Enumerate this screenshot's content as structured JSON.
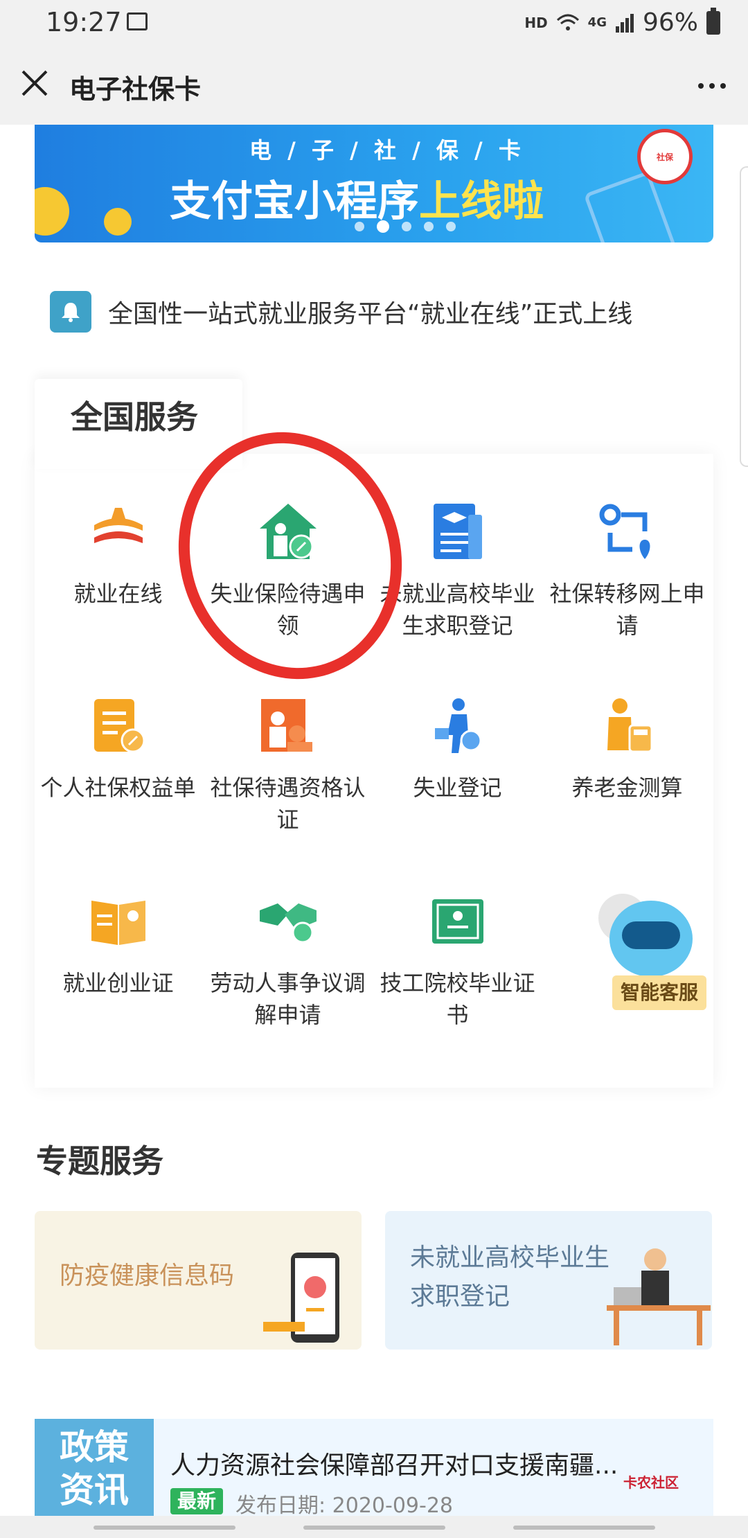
{
  "status_bar": {
    "time": "19:27",
    "hd": "HD",
    "network": "4G",
    "battery": "96%"
  },
  "app_bar": {
    "title": "电子社保卡"
  },
  "banner": {
    "subtitle": "电 / 子 / 社 / 保 / 卡",
    "title_main": "支付宝小程序",
    "title_highlight": "上线啦",
    "slides": 5,
    "active_slide": 1
  },
  "notice": {
    "text": "全国性一站式就业服务平台“就业在线”正式上线"
  },
  "national_services": {
    "title": "全国服务",
    "items": [
      {
        "label": "就业在线",
        "icon": "employment-online-icon"
      },
      {
        "label": "失业保险待遇申领",
        "icon": "unemployment-insurance-icon"
      },
      {
        "label": "未就业高校毕业生求职登记",
        "icon": "graduate-registration-icon"
      },
      {
        "label": "社保转移网上申请",
        "icon": "transfer-icon"
      },
      {
        "label": "个人社保权益单",
        "icon": "rights-document-icon"
      },
      {
        "label": "社保待遇资格认证",
        "icon": "qualification-icon"
      },
      {
        "label": "失业登记",
        "icon": "unemployment-registration-icon"
      },
      {
        "label": "养老金测算",
        "icon": "pension-calculator-icon"
      },
      {
        "label": "就业创业证",
        "icon": "certificate-book-icon"
      },
      {
        "label": "劳动人事争议调解申请",
        "icon": "handshake-icon"
      },
      {
        "label": "技工院校毕业证书",
        "icon": "diploma-icon"
      },
      {
        "label": "",
        "icon": "hidden-service-icon"
      }
    ]
  },
  "smart_service": {
    "label": "智能客服"
  },
  "topic_services": {
    "title": "专题服务",
    "cards": [
      {
        "text": "防疫健康信息码"
      },
      {
        "text_line1": "未就业高校毕业生",
        "text_line2": "求职登记"
      }
    ]
  },
  "policy": {
    "side_line1": "政策",
    "side_line2": "资讯",
    "title": "人力资源社会保障部召开对口支援南疆...",
    "badge": "最新",
    "date": "发布日期: 2020-09-28"
  },
  "watermark": "卡农社区",
  "colors": {
    "accent_blue": "#2a8fe8",
    "orange": "#f5a623",
    "green": "#2eb35c",
    "annotation_red": "#e8302b"
  }
}
